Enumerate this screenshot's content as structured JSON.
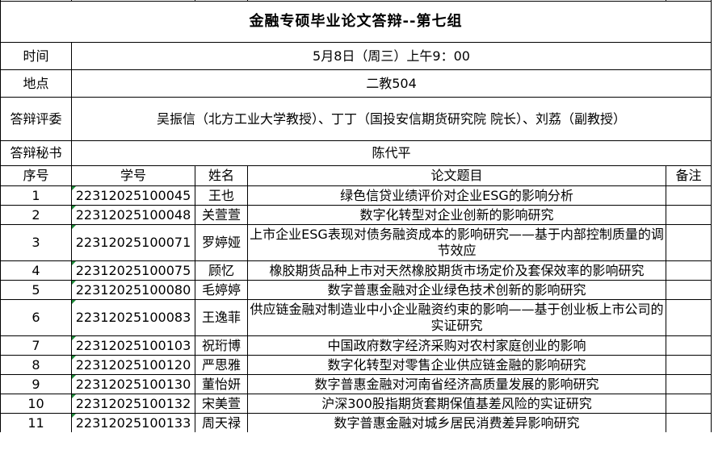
{
  "title": "金融专硕毕业论文答辩--第七组",
  "info": {
    "time_label": "时间",
    "time_value": "5月8日（周三）上午9：00",
    "place_label": "地点",
    "place_value": "二教504",
    "committee_label": "答辩评委",
    "committee_value": "吴振信（北方工业大学教授）、丁丁（国投安信期货研究院 院长）、刘荔（副教授）",
    "secretary_label": "答辩秘书",
    "secretary_value": "陈代平"
  },
  "headers": {
    "seq": "序号",
    "student_id": "学号",
    "name": "姓名",
    "thesis": "论文题目",
    "remark": "备注"
  },
  "rows": [
    {
      "seq": "1",
      "student_id": "22312025100045",
      "name": "王也",
      "thesis": "绿色信贷业绩评价对企业ESG的影响分析",
      "remark": ""
    },
    {
      "seq": "2",
      "student_id": "22312025100048",
      "name": "关萱萱",
      "thesis": "数字化转型对企业创新的影响研究",
      "remark": ""
    },
    {
      "seq": "3",
      "student_id": "22312025100071",
      "name": "罗婷娅",
      "thesis": "上市企业ESG表现对债务融资成本的影响研究——基于内部控制质量的调节效应",
      "remark": ""
    },
    {
      "seq": "4",
      "student_id": "22312025100075",
      "name": "顾忆",
      "thesis": "橡胶期货品种上市对天然橡胶期货市场定价及套保效率的影响研究",
      "remark": ""
    },
    {
      "seq": "5",
      "student_id": "22312025100080",
      "name": "毛婷婷",
      "thesis": "数字普惠金融对企业绿色技术创新的影响研究",
      "remark": ""
    },
    {
      "seq": "6",
      "student_id": "22312025100083",
      "name": "王逸菲",
      "thesis": "供应链金融对制造业中小企业融资约束的影响——基于创业板上市公司的实证研究",
      "remark": ""
    },
    {
      "seq": "7",
      "student_id": "22312025100103",
      "name": "祝珩博",
      "thesis": "中国政府数字经济采购对农村家庭创业的影响",
      "remark": ""
    },
    {
      "seq": "8",
      "student_id": "22312025100120",
      "name": "严思雅",
      "thesis": "数字化转型对零售企业供应链金融的影响研究",
      "remark": ""
    },
    {
      "seq": "9",
      "student_id": "22312025100130",
      "name": "董怡妍",
      "thesis": "数字普惠金融对河南省经济高质量发展的影响研究",
      "remark": ""
    },
    {
      "seq": "10",
      "student_id": "22312025100132",
      "name": "宋美萱",
      "thesis": "沪深300股指期货套期保值基差风险的实证研究",
      "remark": ""
    },
    {
      "seq": "11",
      "student_id": "22312025100133",
      "name": "周天禄",
      "thesis": "数字普惠金融对城乡居民消费差异影响研究",
      "remark": ""
    }
  ],
  "colors": {
    "grid": "#000000",
    "cell_marker": "#1f8a3a"
  }
}
